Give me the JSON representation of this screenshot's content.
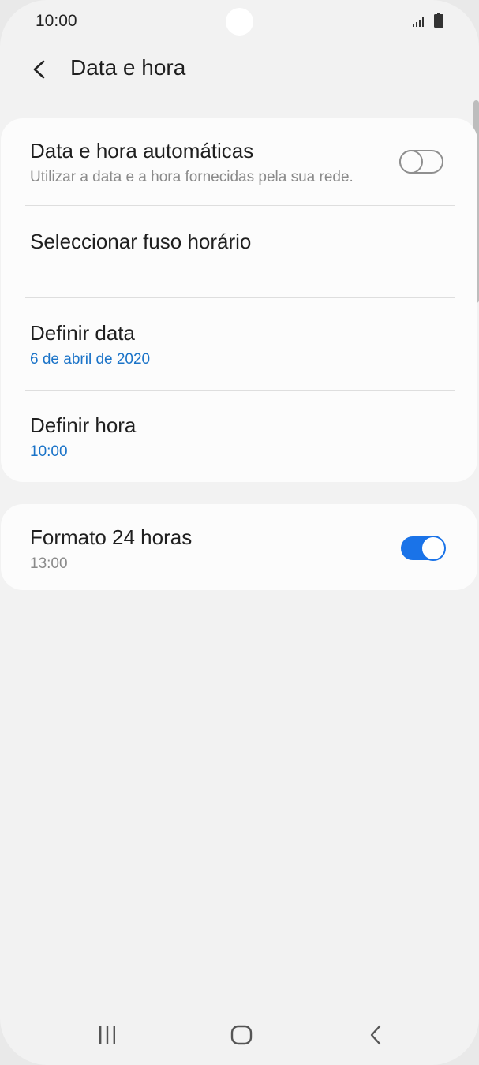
{
  "status_bar": {
    "time": "10:00",
    "icons": [
      "signal-icon",
      "battery-icon"
    ]
  },
  "header": {
    "title": "Data e hora",
    "back_icon": "chevron-left-icon"
  },
  "settings_group_1": [
    {
      "title": "Data e hora automáticas",
      "subtitle": "Utilizar a data e a hora fornecidas pela sua rede.",
      "toggle": false
    },
    {
      "title": "Seleccionar fuso horário",
      "subtitle": ""
    },
    {
      "title": "Definir data",
      "subtitle": "6 de abril de 2020"
    },
    {
      "title": "Definir hora",
      "subtitle": "10:00"
    }
  ],
  "settings_group_2": [
    {
      "title": "Formato 24 horas",
      "subtitle": "13:00",
      "toggle": true
    }
  ],
  "nav_bar": {
    "icons": [
      "recents-icon",
      "home-icon",
      "back-icon"
    ]
  },
  "colors": {
    "accent": "#1a73e8",
    "accent_text": "#1a73c8",
    "background": "#f2f2f2",
    "card": "#fcfcfc"
  }
}
